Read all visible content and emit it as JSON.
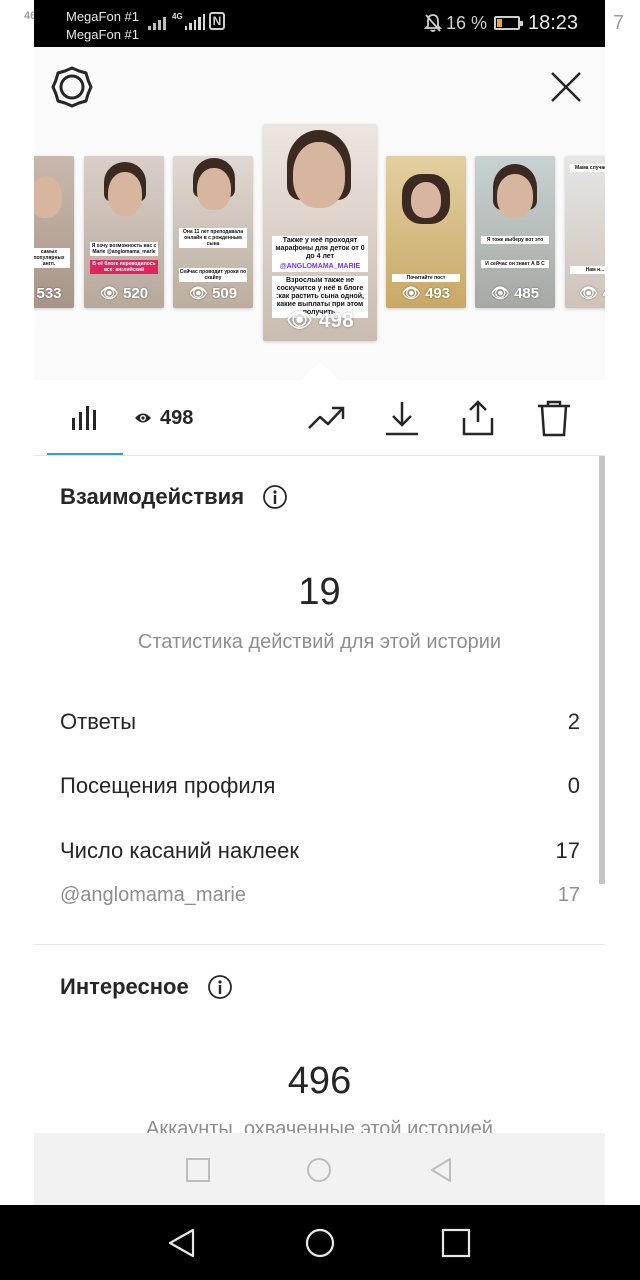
{
  "status_bar": {
    "carrier_1": "MegaFon #1",
    "carrier_2": "MegaFon #1",
    "network": "4G",
    "battery_percent": "16 %",
    "time": "18:23",
    "left_edge_text": "46",
    "right_edge_text": "7"
  },
  "stories": [
    {
      "views": "533",
      "caption_top": "самых популярных англ.",
      "caption_bottom": ""
    },
    {
      "views": "520",
      "caption_top": "Я хочу возможность вас с Marie @anglomama_marie",
      "caption_bottom": "В её блоге переводилось все: английский"
    },
    {
      "views": "509",
      "caption_top": "Она 11 лет преподавала онлайн в с рожденным сына",
      "caption_bottom": "Сейчас проводит уроки по скайпу"
    },
    {
      "views": "498",
      "caption_top": "Также у неё проходят марафоны для деток от 0 до 4 лет",
      "caption_bottom": "Взрослым также не соскучится у неё в блоге :как растить сына одной, какие выплаты при этом получить."
    },
    {
      "views": "493",
      "caption_top": "",
      "caption_bottom": "Почитайте пост"
    },
    {
      "views": "485",
      "caption_top": "Я тоже выберу вот это",
      "caption_bottom": "И сейчас он знает А В С"
    },
    {
      "views": "4",
      "caption_top": "Мама случается",
      "caption_bottom": "Нам н..."
    }
  ],
  "mentions_sticker": "@ANGLOMAMA_MARIE",
  "toolbar": {
    "views_count": "498"
  },
  "interactions": {
    "title": "Взаимодействия",
    "total": "19",
    "caption": "Статистика действий для этой истории",
    "rows": [
      {
        "label": "Ответы",
        "value": "2"
      },
      {
        "label": "Посещения профиля",
        "value": "0"
      },
      {
        "label": "Число касаний наклеек",
        "value": "17"
      }
    ],
    "sticker_row": {
      "label": "@anglomama_marie",
      "value": "17"
    }
  },
  "discovery": {
    "title": "Интересное",
    "total": "496",
    "caption": "Аккаунты, охваченные этой историей"
  },
  "colors": {
    "accent": "#3897f0",
    "text": "#262626",
    "muted": "#8e8e8e",
    "header_bg": "#fafafa"
  }
}
